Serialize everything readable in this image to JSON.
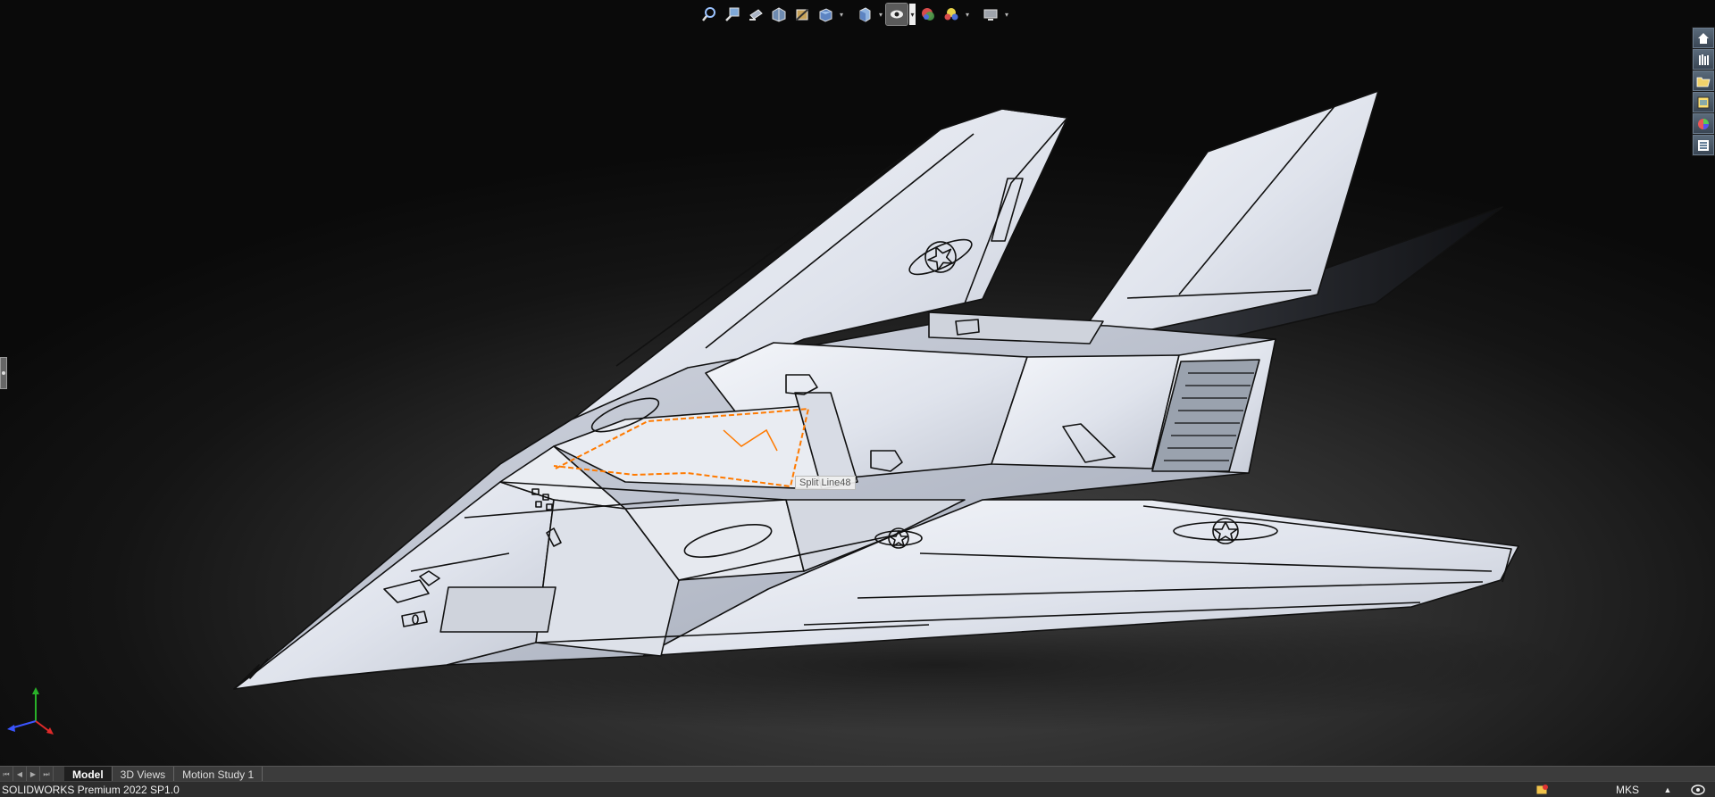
{
  "app": {
    "status_text": "SOLIDWORKS Premium 2022 SP1.0",
    "unit_system": "MKS",
    "unit_arrow": "▲"
  },
  "tooltip": {
    "text": "Split Line48"
  },
  "tabs": [
    {
      "label": "Model",
      "active": true
    },
    {
      "label": "3D Views",
      "active": false
    },
    {
      "label": "Motion Study 1",
      "active": false
    }
  ],
  "nav_arrows": [
    "⏮",
    "◀",
    "▶",
    "⏭"
  ],
  "hud_icons": [
    "zoom-to-fit-icon",
    "zoom-to-area-icon",
    "previous-view-icon",
    "section-view-icon",
    "dynamic-annotation-icon",
    "view-orientation-icon",
    "display-style-icon",
    "hide-show-items-icon",
    "edit-appearance-icon",
    "apply-scene-icon",
    "view-settings-icon"
  ],
  "task_pane_icons": [
    "solidworks-resources-icon",
    "design-library-icon",
    "file-explorer-icon",
    "view-palette-icon",
    "appearances-icon",
    "custom-properties-icon"
  ],
  "colors": {
    "highlight": "#ff7a00",
    "model_edge": "#111111"
  }
}
